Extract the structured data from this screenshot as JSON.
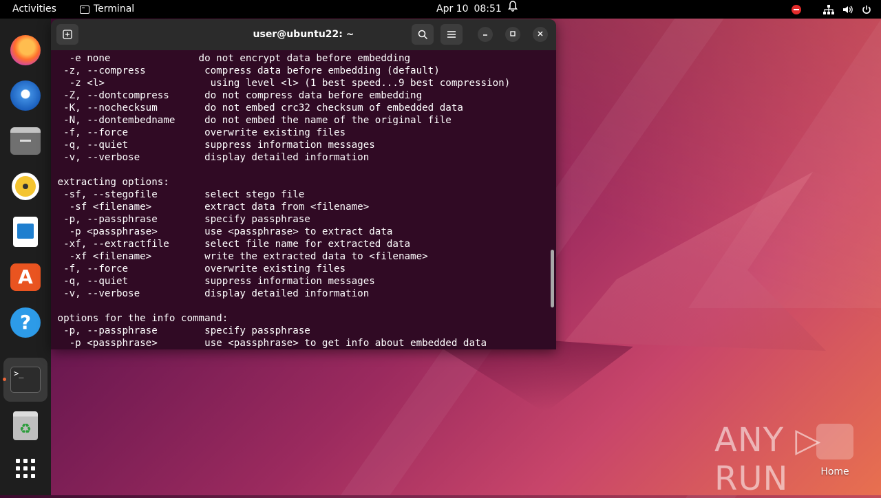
{
  "topbar": {
    "activities": "Activities",
    "app_name": "Terminal",
    "date": "Apr 10",
    "time": "08:51"
  },
  "window": {
    "title": "user@ubuntu22: ~"
  },
  "terminal_lines": [
    "   -e none               do not encrypt data before embedding",
    "  -z, --compress          compress data before embedding (default)",
    "   -z <l>                  using level <l> (1 best speed...9 best compression)",
    "  -Z, --dontcompress      do not compress data before embedding",
    "  -K, --nochecksum        do not embed crc32 checksum of embedded data",
    "  -N, --dontembedname     do not embed the name of the original file",
    "  -f, --force             overwrite existing files",
    "  -q, --quiet             suppress information messages",
    "  -v, --verbose           display detailed information",
    "",
    " extracting options:",
    "  -sf, --stegofile        select stego file",
    "   -sf <filename>         extract data from <filename>",
    "  -p, --passphrase        specify passphrase",
    "   -p <passphrase>        use <passphrase> to extract data",
    "  -xf, --extractfile      select file name for extracted data",
    "   -xf <filename>         write the extracted data to <filename>",
    "  -f, --force             overwrite existing files",
    "  -q, --quiet             suppress information messages",
    "  -v, --verbose           display detailed information",
    "",
    " options for the info command:",
    "  -p, --passphrase        specify passphrase",
    "   -p <passphrase>        use <passphrase> to get info about embedded data"
  ],
  "desktop": {
    "watermark": "ANY ▷ RUN",
    "home_label": "Home"
  },
  "dock": {
    "terminal_prompt": ">_",
    "help_glyph": "?",
    "appstore_glyph": "A",
    "trash_glyph": "♻"
  },
  "colors": {
    "terminal_bg": "#300a24",
    "header_bg": "#2b2b2b",
    "accent": "#e95420"
  }
}
